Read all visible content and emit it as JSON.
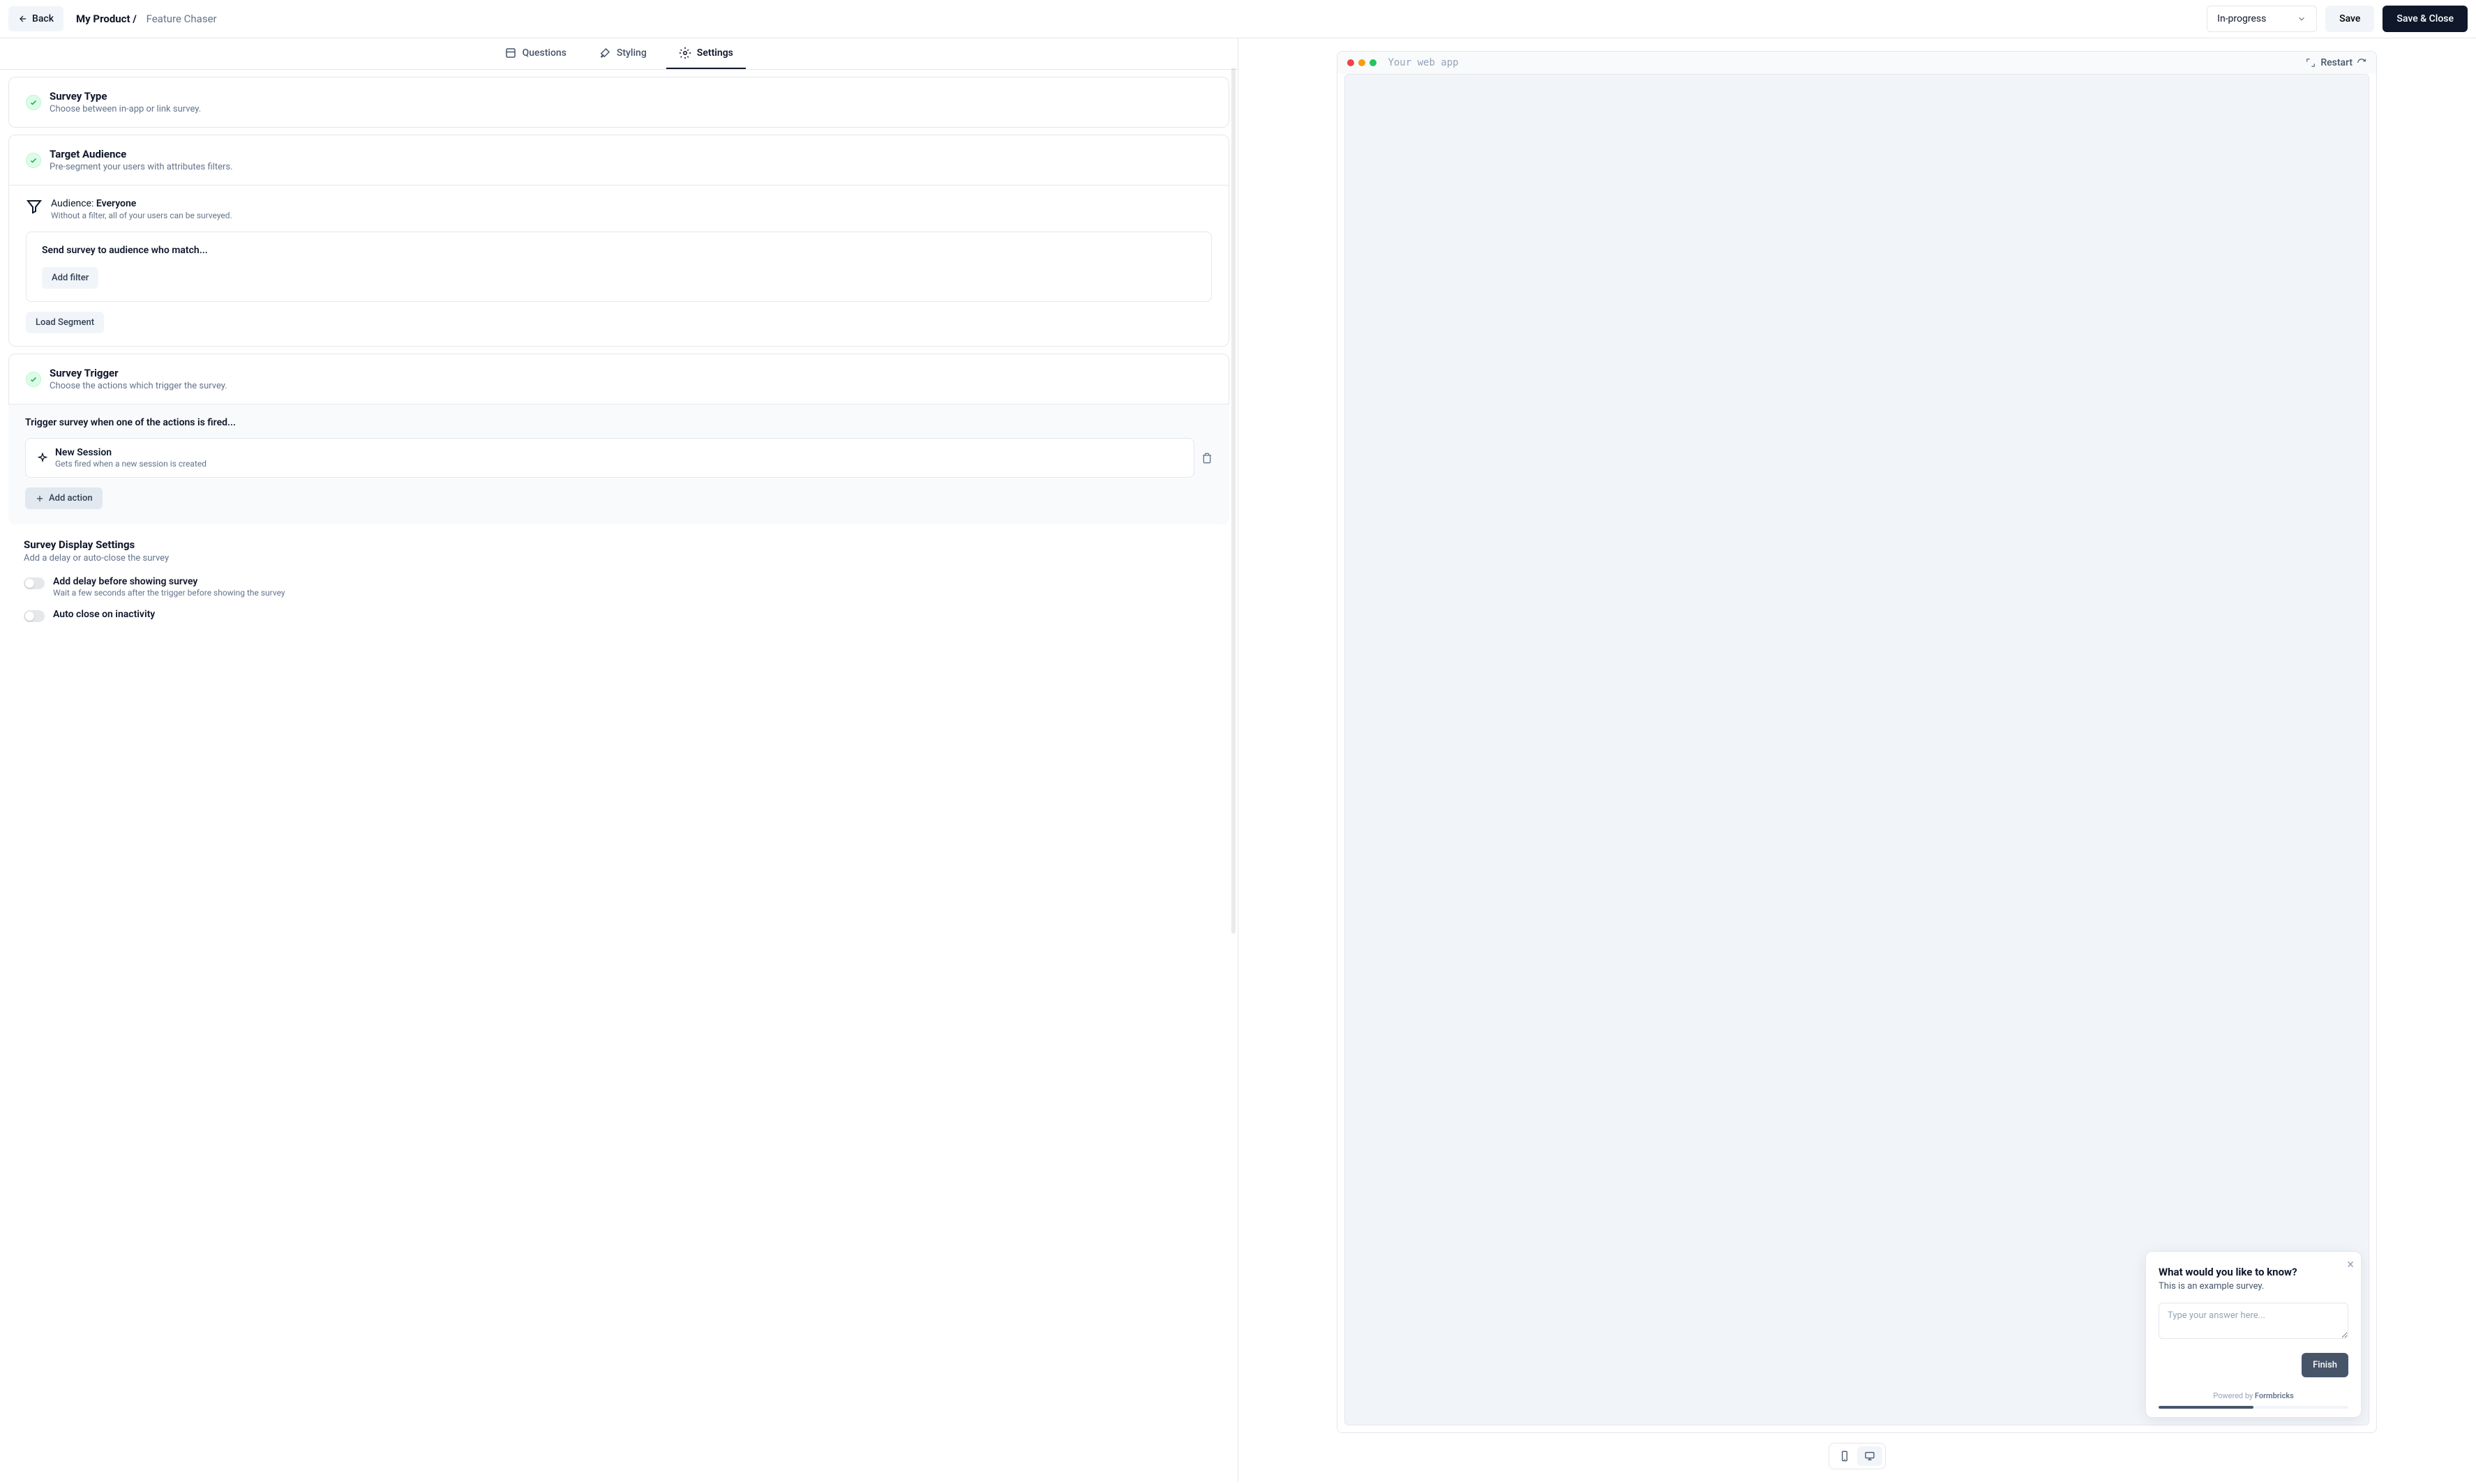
{
  "header": {
    "back_label": "Back",
    "breadcrumb_product": "My Product /",
    "breadcrumb_page": "Feature Chaser",
    "status_value": "In-progress",
    "save_label": "Save",
    "save_close_label": "Save & Close"
  },
  "tabs": {
    "questions": "Questions",
    "styling": "Styling",
    "settings": "Settings"
  },
  "cards": {
    "survey_type": {
      "title": "Survey Type",
      "sub": "Choose between in-app or link survey."
    },
    "target_audience": {
      "title": "Target Audience",
      "sub": "Pre-segment your users with attributes filters."
    },
    "audience_label_prefix": "Audience: ",
    "audience_value": "Everyone",
    "audience_desc": "Without a filter, all of your users can be surveyed.",
    "filter_box_title": "Send survey to audience who match...",
    "add_filter_label": "Add filter",
    "load_segment_label": "Load Segment",
    "survey_trigger": {
      "title": "Survey Trigger",
      "sub": "Choose the actions which trigger the survey."
    },
    "trigger_box_title": "Trigger survey when one of the actions is fired...",
    "trigger_item": {
      "name": "New Session",
      "desc": "Gets fired when a new session is created"
    },
    "add_action_label": "Add action"
  },
  "display": {
    "title": "Survey Display Settings",
    "sub": "Add a delay or auto-close the survey",
    "delay": {
      "label": "Add delay before showing survey",
      "desc": "Wait a few seconds after the trigger before showing the survey"
    },
    "autoclose": {
      "label": "Auto close on inactivity"
    }
  },
  "preview": {
    "title": "Your web app",
    "restart_label": "Restart"
  },
  "survey_popup": {
    "question": "What would you like to know?",
    "desc": "This is an example survey.",
    "placeholder": "Type your answer here...",
    "finish_label": "Finish",
    "powered_prefix": "Powered by ",
    "powered_brand": "Formbricks"
  }
}
